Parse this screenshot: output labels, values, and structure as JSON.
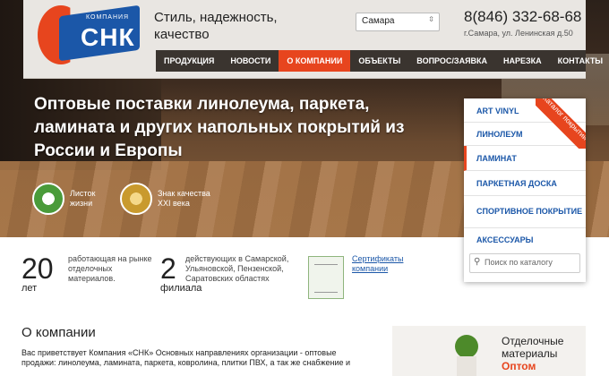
{
  "header": {
    "logo_company": "КОМПАНИЯ",
    "logo_brand": "СНК",
    "slogan": "Стиль, надежность, качество",
    "city_select": "Самара",
    "phone": "8(846) 332-68-68",
    "address": "г.Самара, ул. Ленинская д.50"
  },
  "nav": {
    "items": [
      "ПРОДУКЦИЯ",
      "НОВОСТИ",
      "О КОМПАНИИ",
      "ОБЪЕКТЫ",
      "ВОПРОС/ЗАЯВКА",
      "НАРЕЗКА",
      "КОНТАКТЫ"
    ],
    "active": "О КОМПАНИИ",
    "menu_icon": "≡"
  },
  "hero": {
    "headline": "Оптовые поставки линолеума, паркета, ламината и других напольных покрытий из России и Европы",
    "badge1": "Листок жизни",
    "badge2": "Знак качества XXI века"
  },
  "catalog": {
    "ribbon": "Каталог покрытий",
    "items": [
      "ART VINYL",
      "ЛИНОЛЕУМ",
      "ЛАМИНАТ",
      "ПАРКЕТНАЯ ДОСКА",
      "СПОРТИВНОЕ ПОКРЫТИЕ",
      "АКСЕССУАРЫ"
    ],
    "selected": "ЛАМИНАТ",
    "search_placeholder": "Поиск по каталогу"
  },
  "stats": {
    "years_num": "20",
    "years_unit": "лет",
    "years_desc": "работающая на рынке отделочных материалов.",
    "branches_num": "2",
    "branches_unit": "филиала",
    "branches_desc": "действующих в Самарской, Ульяновской, Пензенской, Саратовских областях",
    "cert_link": "Сертификаты компании"
  },
  "about": {
    "title": "О компании",
    "text": "Вас приветствует Компания «СНК» Основных направлениях организации - оптовые продажи: линолеума, ламината, паркета, ковролина, плитки ПВХ, а так же снабжение и"
  },
  "promo": {
    "line1": "Отделочные",
    "line2": "материалы",
    "line3": "Оптом"
  },
  "colors": {
    "accent": "#e7451e",
    "brand_blue": "#1b57a8",
    "nav_bg": "#3a342f"
  }
}
